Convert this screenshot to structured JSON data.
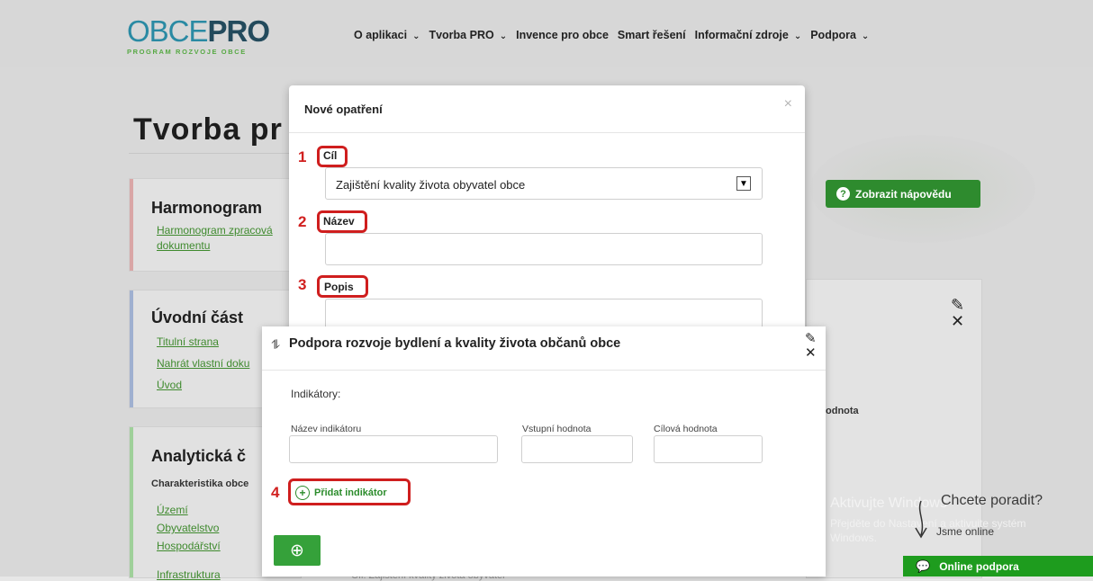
{
  "header": {
    "logo_obce": "OBCE",
    "logo_pro": "PRO",
    "logo_sub": "PROGRAM ROZVOJE OBCE",
    "nav": [
      {
        "label": "O aplikaci",
        "chevron": true
      },
      {
        "label": "Tvorba PRO",
        "chevron": true
      },
      {
        "label": "Invence pro obce",
        "chevron": false
      },
      {
        "label": "Smart řešení",
        "chevron": false
      },
      {
        "label": "Informační zdroje",
        "chevron": true
      },
      {
        "label": "Podpora",
        "chevron": true
      }
    ]
  },
  "page": {
    "title": "Tvorba pr",
    "help_button": "Zobrazit nápovědu",
    "harmonogram": {
      "title": "Harmonogram",
      "link1": "Harmonogram zpracová",
      "link2": "dokumentu"
    },
    "uvodni": {
      "title": "Úvodní část",
      "links": [
        "Titulní strana",
        "Nahrát vlastní doku",
        "Úvod"
      ]
    },
    "analyticka": {
      "title": "Analytická č",
      "subtitle": "Charakteristika obce",
      "links": [
        "Území",
        "Obyvatelstvo",
        "Hospodářství",
        "Infrastruktura"
      ]
    },
    "right_col_label": "odnota"
  },
  "modal": {
    "title": "Nové opatření",
    "close": "×",
    "fields": [
      {
        "step": "1",
        "label": "Cíl"
      },
      {
        "step": "2",
        "label": "Název"
      },
      {
        "step": "3",
        "label": "Popis"
      }
    ],
    "select_value": "Zajištění kvality života obyvatel obce"
  },
  "panel2": {
    "title": "Podpora rozvoje bydlení a kvality života občanů obce",
    "indicators_label": "Indikátory:",
    "col_name": "Název indikátoru",
    "col_input": "Vstupní hodnota",
    "col_target": "Cílová hodnota",
    "step4": "4",
    "add_indicator": "Přidat indikátor"
  },
  "overlay": {
    "watermark1": "Aktivujte Windows",
    "watermark2a": "Přejděte do Nastavení a aktivujte systém",
    "watermark2b": "Windows.",
    "help_question": "Chcete poradit?",
    "we_are_online": "Jsme online",
    "online_support": "Online podpora",
    "bottom_faint": "Cíl: Zajištění kvality života obyvatel"
  }
}
